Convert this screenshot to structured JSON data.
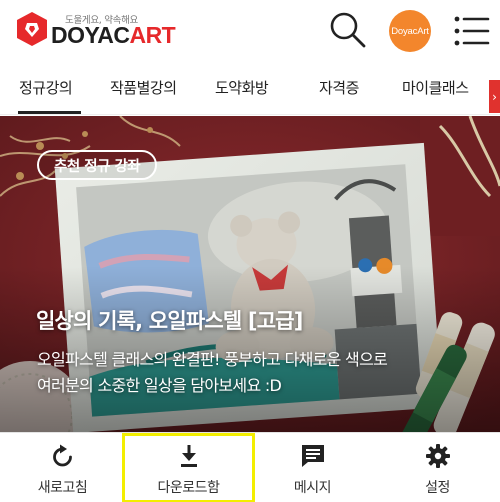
{
  "header": {
    "logo_tagline": "도울게요, 약속해요",
    "logo_word_main": "DOYAC",
    "logo_word_accent": "ART",
    "avatar_text": "DoyacArt"
  },
  "categories": [
    {
      "label": "정규강의",
      "active": true
    },
    {
      "label": "작품별강의",
      "active": false
    },
    {
      "label": "도약화방",
      "active": false
    },
    {
      "label": "자격증",
      "active": false
    },
    {
      "label": "마이클래스",
      "active": false
    }
  ],
  "banner": {
    "badge": "추천 정규 강좌",
    "title": "일상의 기록, 오일파스텔 [고급]",
    "description_line1": "오일파스텔 클래스의 완결판! 풍부하고 다채로운 색으로",
    "description_line2": "여러분의 소중한 일상을 담아보세요 :D"
  },
  "bottom_tabs": [
    {
      "label": "새로고침",
      "icon": "refresh-icon"
    },
    {
      "label": "다운로드함",
      "icon": "download-icon"
    },
    {
      "label": "메시지",
      "icon": "message-icon"
    },
    {
      "label": "설정",
      "icon": "gear-icon"
    }
  ],
  "colors": {
    "brand_red": "#e6292b",
    "avatar_orange": "#f3862c",
    "highlight_yellow": "#f3ee00",
    "banner_bg": "#7a2427"
  }
}
